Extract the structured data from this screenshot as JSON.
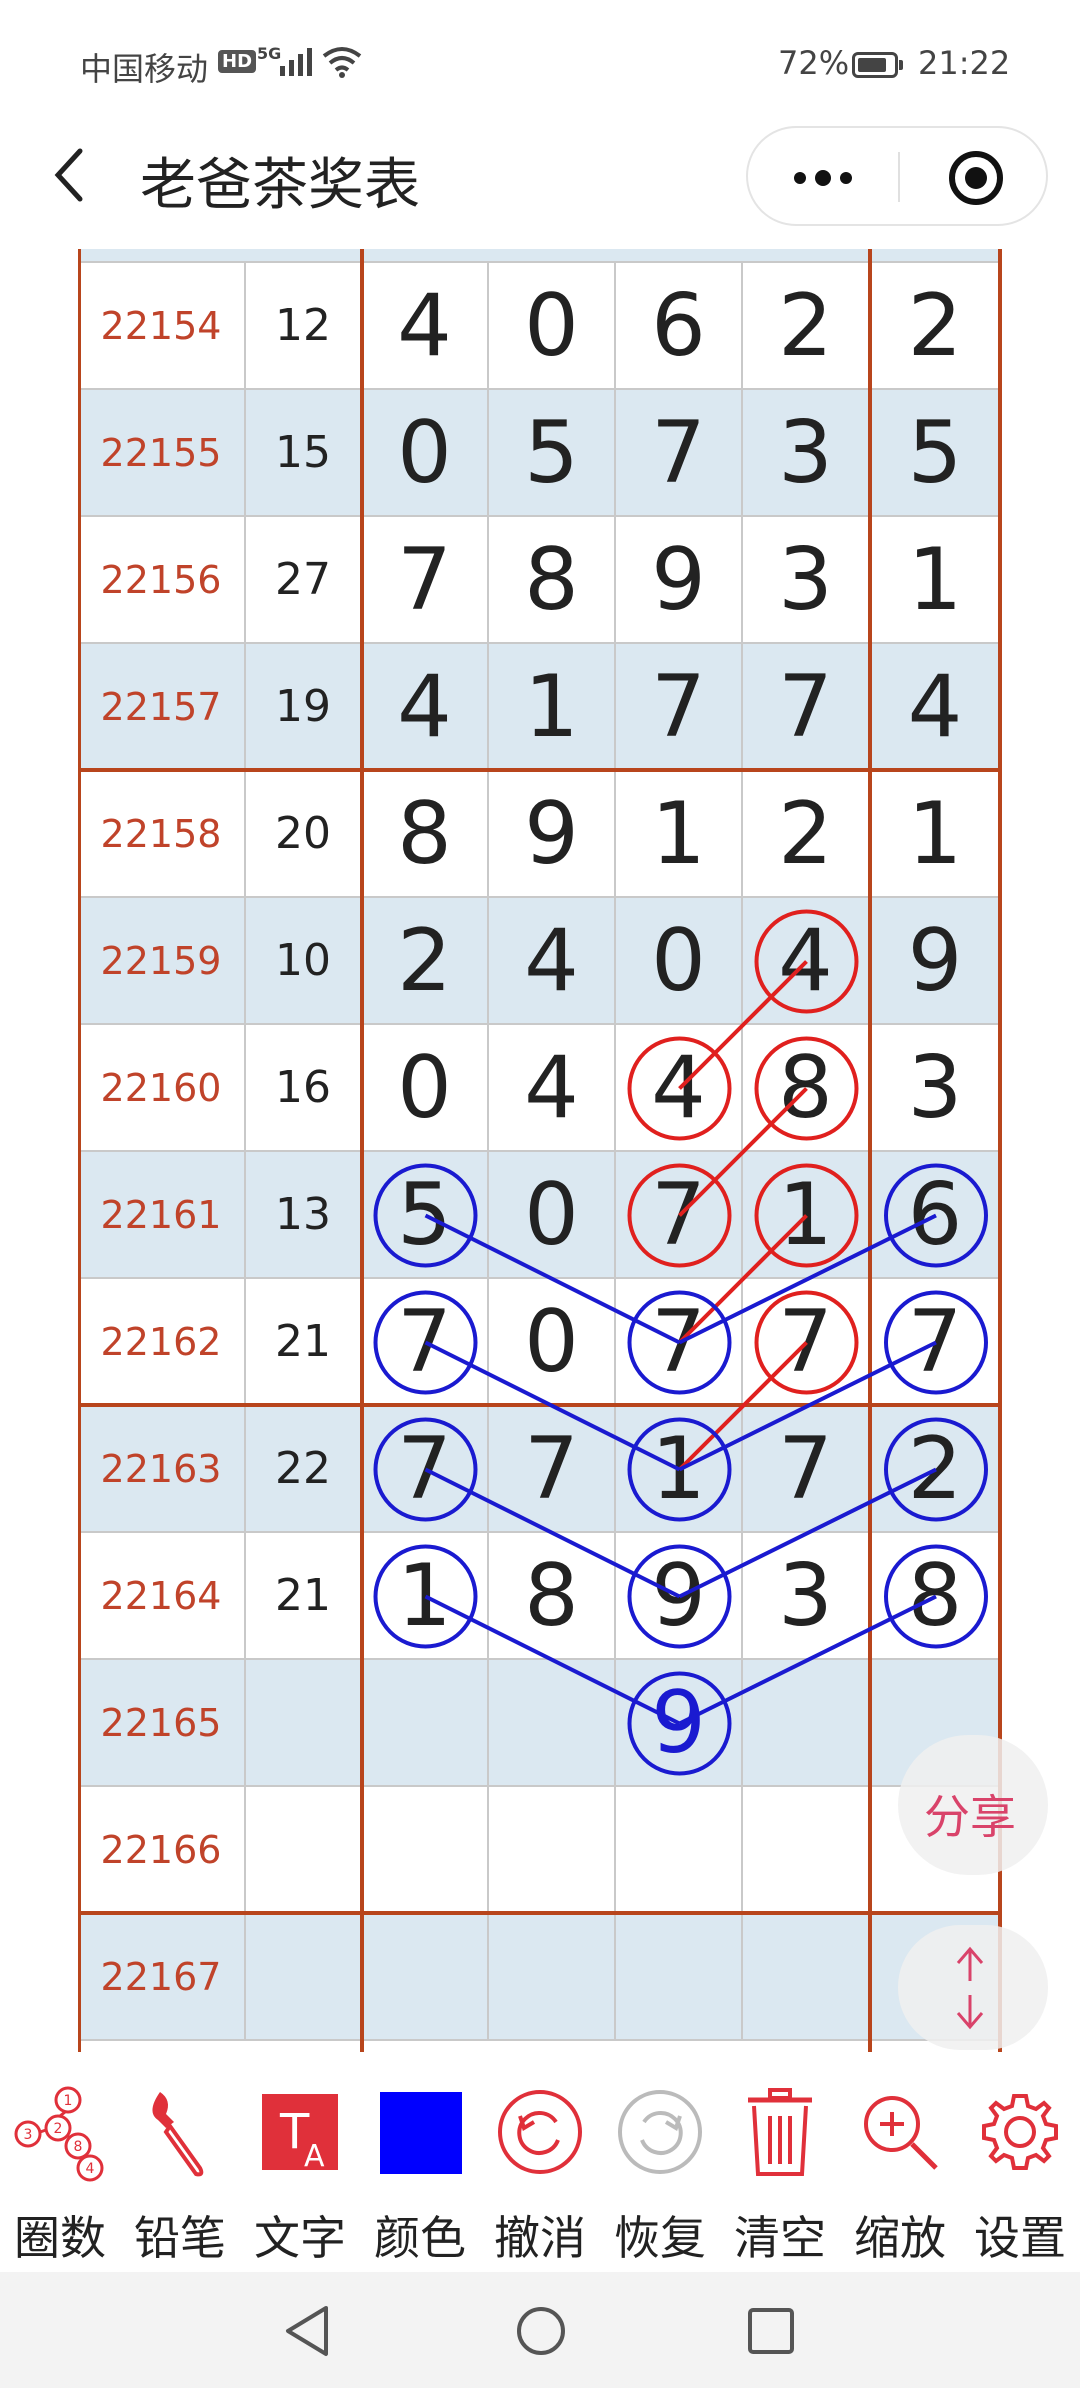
{
  "status_bar": {
    "carrier": "中国移动",
    "hd": "HD",
    "network": "5G",
    "battery": "72%",
    "time": "21:22"
  },
  "header": {
    "title": "老爸茶奖表"
  },
  "colors": {
    "issue_text": "#c0432a",
    "shade": "#dbe8f1",
    "circle_red": "#e0201e",
    "circle_blue": "#1a1ad0",
    "grid_major": "#b8451c",
    "accent": "#d9436a"
  },
  "rows": [
    {
      "issue": "22154",
      "sum": "12",
      "digits": [
        "4",
        "0",
        "6",
        "2",
        "2"
      ]
    },
    {
      "issue": "22155",
      "sum": "15",
      "digits": [
        "0",
        "5",
        "7",
        "3",
        "5"
      ]
    },
    {
      "issue": "22156",
      "sum": "27",
      "digits": [
        "7",
        "8",
        "9",
        "3",
        "1"
      ]
    },
    {
      "issue": "22157",
      "sum": "19",
      "digits": [
        "4",
        "1",
        "7",
        "7",
        "4"
      ]
    },
    {
      "issue": "22158",
      "sum": "20",
      "digits": [
        "8",
        "9",
        "1",
        "2",
        "1"
      ]
    },
    {
      "issue": "22159",
      "sum": "10",
      "digits": [
        "2",
        "4",
        "0",
        "4",
        "9"
      ]
    },
    {
      "issue": "22160",
      "sum": "16",
      "digits": [
        "0",
        "4",
        "4",
        "8",
        "3"
      ]
    },
    {
      "issue": "22161",
      "sum": "13",
      "digits": [
        "5",
        "0",
        "7",
        "1",
        "6"
      ]
    },
    {
      "issue": "22162",
      "sum": "21",
      "digits": [
        "7",
        "0",
        "7",
        "7",
        "7"
      ]
    },
    {
      "issue": "22163",
      "sum": "22",
      "digits": [
        "7",
        "7",
        "1",
        "7",
        "2"
      ]
    },
    {
      "issue": "22164",
      "sum": "21",
      "digits": [
        "1",
        "8",
        "9",
        "3",
        "8"
      ]
    },
    {
      "issue": "22165",
      "sum": "",
      "digits": [
        "",
        "",
        "9",
        "",
        ""
      ]
    },
    {
      "issue": "22166",
      "sum": "",
      "digits": [
        "",
        "",
        "",
        "",
        ""
      ]
    },
    {
      "issue": "22167",
      "sum": "",
      "digits": [
        "",
        "",
        "",
        "",
        ""
      ]
    }
  ],
  "red_circles": [
    [
      5,
      3
    ],
    [
      6,
      2
    ],
    [
      6,
      3
    ],
    [
      7,
      2
    ],
    [
      7,
      3
    ],
    [
      8,
      3
    ]
  ],
  "blue_circles": [
    [
      7,
      0
    ],
    [
      7,
      4
    ],
    [
      8,
      0
    ],
    [
      8,
      2
    ],
    [
      8,
      4
    ],
    [
      9,
      0
    ],
    [
      9,
      2
    ],
    [
      9,
      4
    ],
    [
      10,
      0
    ],
    [
      10,
      2
    ],
    [
      10,
      4
    ],
    [
      11,
      2
    ]
  ],
  "red_lines": [
    [
      [
        5,
        3
      ],
      [
        6,
        2
      ]
    ],
    [
      [
        6,
        3
      ],
      [
        7,
        2
      ]
    ],
    [
      [
        7,
        3
      ],
      [
        8,
        2
      ]
    ],
    [
      [
        8,
        3
      ],
      [
        9,
        2
      ]
    ]
  ],
  "blue_lines": [
    [
      [
        7,
        0
      ],
      [
        8,
        2
      ]
    ],
    [
      [
        8,
        2
      ],
      [
        7,
        4
      ]
    ],
    [
      [
        8,
        0
      ],
      [
        9,
        2
      ]
    ],
    [
      [
        9,
        2
      ],
      [
        8,
        4
      ]
    ],
    [
      [
        9,
        0
      ],
      [
        10,
        2
      ]
    ],
    [
      [
        10,
        2
      ],
      [
        9,
        4
      ]
    ],
    [
      [
        10,
        0
      ],
      [
        11,
        2
      ]
    ],
    [
      [
        11,
        2
      ],
      [
        10,
        4
      ]
    ]
  ],
  "predicted_cells": [
    [
      11,
      2
    ]
  ],
  "floating": {
    "share_label": "分享"
  },
  "toolbar": {
    "items": [
      {
        "label": "圈数",
        "icon": "circle-numbers-icon"
      },
      {
        "label": "铅笔",
        "icon": "pencil-brush-icon"
      },
      {
        "label": "文字",
        "icon": "text-icon"
      },
      {
        "label": "颜色",
        "icon": "color-swatch-icon"
      },
      {
        "label": "撤消",
        "icon": "undo-icon"
      },
      {
        "label": "恢复",
        "icon": "redo-icon"
      },
      {
        "label": "清空",
        "icon": "trash-icon"
      },
      {
        "label": "缩放",
        "icon": "zoom-in-icon"
      },
      {
        "label": "设置",
        "icon": "gear-icon"
      }
    ],
    "text_icon_glyph": "T",
    "text_icon_sub": "A",
    "circle_icon_digits": [
      "1",
      "2",
      "3",
      "8",
      "4"
    ]
  }
}
